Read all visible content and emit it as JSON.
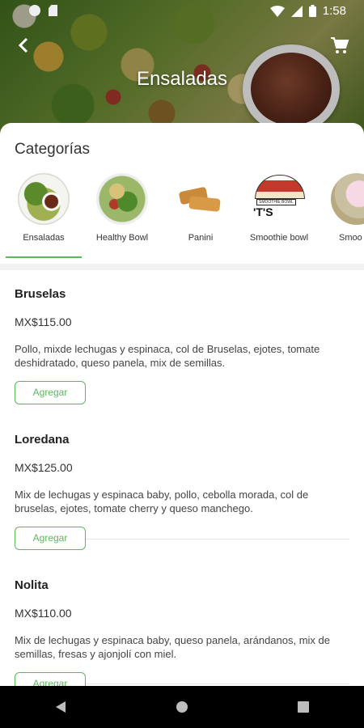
{
  "status": {
    "time": "1:58"
  },
  "header": {
    "title": "Ensaladas"
  },
  "categories": {
    "title": "Categorías",
    "items": [
      {
        "label": "Ensaladas"
      },
      {
        "label": "Healthy Bowl"
      },
      {
        "label": "Panini"
      },
      {
        "label": "Smoothie bowl"
      },
      {
        "label": "Smoo"
      }
    ],
    "selected": "Ensaladas",
    "smoothie_bowl_logo_text": "SMOOTHIE BOWL",
    "smoothie_bowl_partial_text": "'T'S"
  },
  "products": [
    {
      "name": "Bruselas",
      "price": "MX$115.00",
      "description": "Pollo, mixde lechugas y espinaca, col de Bruselas, ejotes, tomate deshidratado, queso panela, mix de semillas.",
      "button": "Agregar"
    },
    {
      "name": "Loredana",
      "price": "MX$125.00",
      "description": "Mix de lechugas y espinaca baby, pollo, cebolla morada, col de bruselas, ejotes, tomate cherry y queso manchego.",
      "button": "Agregar"
    },
    {
      "name": "Nolita",
      "price": "MX$110.00",
      "description": "Mix de lechugas y espinaca baby, queso panela, arándanos, mix de semillas, fresas y ajonjolí con miel.",
      "button": "Agregar"
    }
  ],
  "colors": {
    "accent": "#5cb85c",
    "navbar": "#000000"
  }
}
